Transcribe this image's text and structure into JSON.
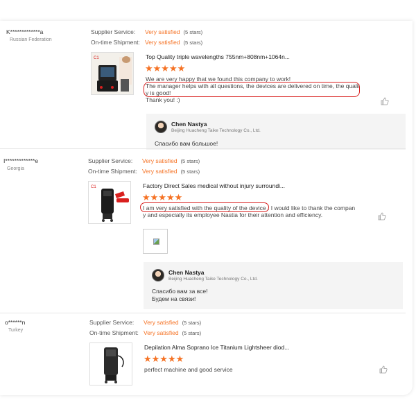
{
  "labels": {
    "supplier_service": "Supplier Service:",
    "on_time_shipment": "On-time Shipment:"
  },
  "reviews": [
    {
      "user": "K*************a",
      "country": "Russian Federation",
      "supplier_service": "Very satisfied",
      "supplier_stars": "(5 stars)",
      "shipment": "Very satisfied",
      "shipment_stars": "(5 stars)",
      "product_title": "Top Quality triple wavelengths 755nm+808nm+1064n...",
      "rating": 5,
      "comment_lines": [
        "We are very happy that we found this company to work!",
        "The manager helps with all questions, the devices are delivered on time, the qualit",
        "y is good!",
        "Thank you! :)"
      ],
      "reply": {
        "name": "Chen Nastya",
        "company": "Beijing Huacheng Taike Technology Co., Ltd.",
        "message_lines": [
          "Спасибо вам большое!"
        ]
      }
    },
    {
      "user": "I*************e",
      "country": "Georgia",
      "supplier_service": "Very satisfied",
      "supplier_stars": "(5 stars)",
      "shipment": "Very satisfied",
      "shipment_stars": "(5 stars)",
      "product_title": "Factory Direct Sales medical without injury surroundi...",
      "rating": 5,
      "comment_lines": [
        "I am very satisfied with the quality of the device . I would like to thank the compan",
        "y and especially its employee Nastia for their attention and efficiency."
      ],
      "reply": {
        "name": "Chen Nastya",
        "company": "Beijing Huacheng Taike Technology Co., Ltd.",
        "message_lines": [
          "Спасибо вам за все!",
          "Будем на связи!"
        ]
      }
    },
    {
      "user": "o******n",
      "country": "Turkey",
      "supplier_service": "Very satisfied",
      "supplier_stars": "(5 stars)",
      "shipment": "Very satisfied",
      "shipment_stars": "(5 stars)",
      "product_title": "Depilation Alma Soprano Ice Titanium Lightsheer diod...",
      "rating": 5,
      "comment_lines": [
        "perfect machine and good service"
      ]
    }
  ],
  "colors": {
    "accent": "#f57224",
    "highlight": "#d9201f"
  },
  "icons": {
    "like": "thumbs-up-icon",
    "star": "star-icon"
  }
}
